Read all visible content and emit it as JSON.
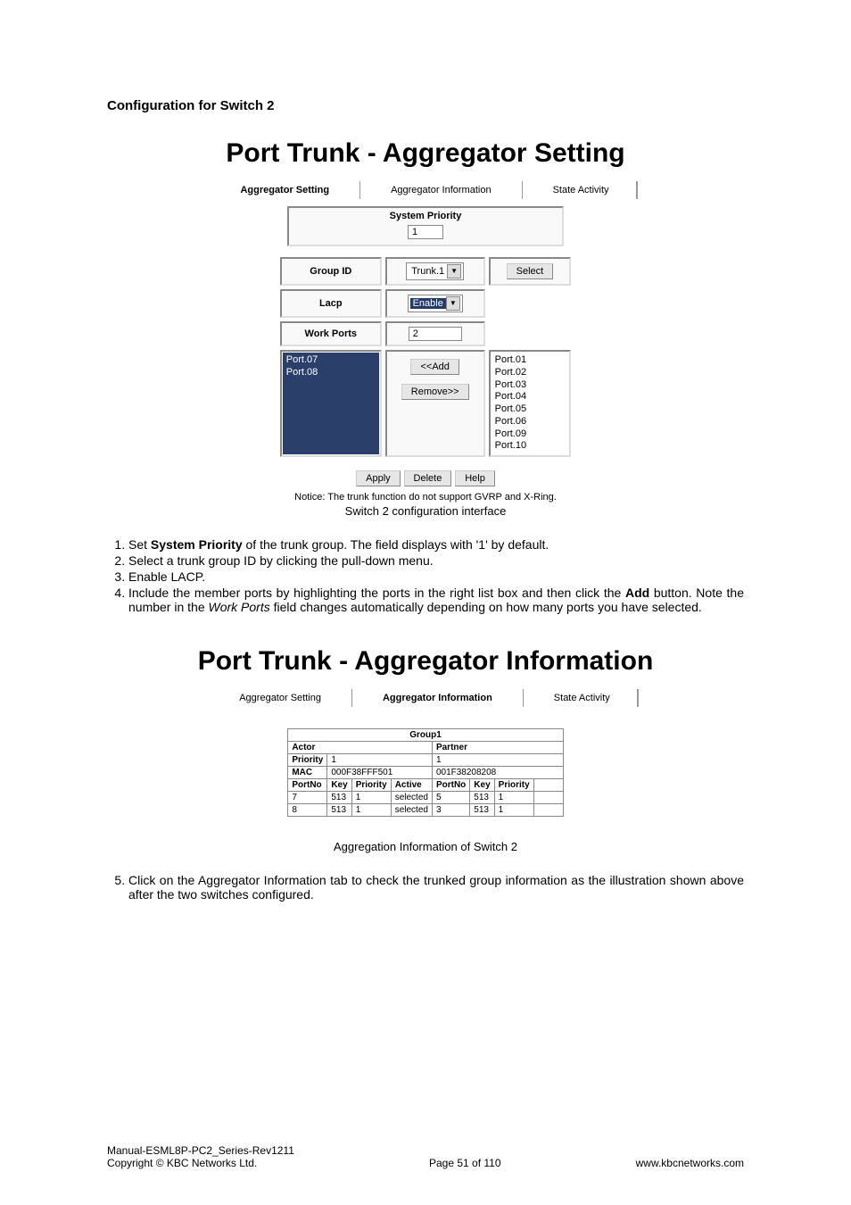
{
  "section_heading": "Configuration for Switch 2",
  "setting": {
    "title": "Port Trunk - Aggregator Setting",
    "tabs": {
      "active": "Aggregator Setting",
      "mid": "Aggregator Information",
      "right": "State Activity"
    },
    "sys_priority_label": "System Priority",
    "sys_priority_value": "1",
    "labels": {
      "group_id": "Group ID",
      "lacp": "Lacp",
      "work_ports": "Work Ports"
    },
    "group_id_value": "Trunk.1",
    "lacp_value": "Enable",
    "work_ports_value": "2",
    "select_btn": "Select",
    "add_btn": "<<Add",
    "remove_btn": "Remove>>",
    "left_ports": [
      "Port.07",
      "Port.08"
    ],
    "right_ports": [
      "Port.01",
      "Port.02",
      "Port.03",
      "Port.04",
      "Port.05",
      "Port.06",
      "Port.09",
      "Port.10"
    ],
    "apply_btn": "Apply",
    "delete_btn": "Delete",
    "help_btn": "Help",
    "notice": "Notice: The trunk function do not support GVRP and X-Ring.",
    "caption": "Switch 2 configuration interface"
  },
  "steps_a": {
    "1": "Set ",
    "1b": "System Priority",
    "1c": " of the trunk group. The field displays with '1' by default.",
    "2": "Select a trunk group ID by clicking the pull-down menu.",
    "3": "Enable LACP.",
    "4a": "Include the member ports by highlighting the ports in the right list box and then click the ",
    "4b": "Add",
    "4c": " button. Note the number in the ",
    "4d": "Work Ports",
    "4e": " field changes automatically depending on how many ports you have selected."
  },
  "info": {
    "title": "Port Trunk - Aggregator Information",
    "tabs": {
      "left": "Aggregator Setting",
      "active": "Aggregator Information",
      "right": "State Activity"
    },
    "group_header": "Group1",
    "labels": {
      "actor": "Actor",
      "partner": "Partner",
      "priority": "Priority",
      "mac": "MAC",
      "portno": "PortNo",
      "key": "Key",
      "priority2": "Priority",
      "active": "Active"
    },
    "actor_priority": "1",
    "partner_priority": "1",
    "actor_mac": "000F38FFF501",
    "partner_mac": "001F38208208",
    "rows": [
      {
        "a_port": "7",
        "a_key": "513",
        "a_pri": "1",
        "a_act": "selected",
        "p_port": "5",
        "p_key": "513",
        "p_pri": "1"
      },
      {
        "a_port": "8",
        "a_key": "513",
        "a_pri": "1",
        "a_act": "selected",
        "p_port": "3",
        "p_key": "513",
        "p_pri": "1"
      }
    ],
    "caption": "Aggregation Information of Switch 2"
  },
  "steps_b": {
    "5": "Click on the Aggregator Information tab to check the trunked group information as the illustration shown above after the two switches configured."
  },
  "footer": {
    "l1": "Manual-ESML8P-PC2_Series-Rev1211",
    "l2": "Copyright © KBC Networks Ltd.",
    "center": "Page 51 of 110",
    "right": "www.kbcnetworks.com"
  }
}
